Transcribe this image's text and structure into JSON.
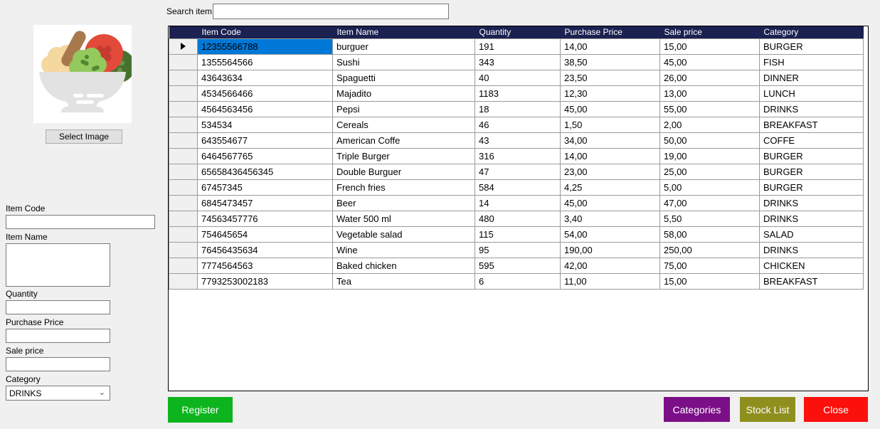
{
  "colors": {
    "header_bg": "#1b2150",
    "selection_bg": "#0078d7",
    "grid_line": "#9b9b9b",
    "register": "#0db41e",
    "categories": "#7b0f87",
    "stock_list": "#8f8f1e",
    "close": "#fb100c"
  },
  "form": {
    "select_image_label": "Select Image",
    "fields": {
      "item_code_label": "Item Code",
      "item_name_label": "Item Name",
      "quantity_label": "Quantity",
      "purchase_price_label": "Purchase Price",
      "sale_price_label": "Sale price",
      "category_label": "Category",
      "category_value": "DRINKS"
    }
  },
  "search": {
    "label": "Search item",
    "value": ""
  },
  "grid": {
    "columns": [
      "Item Code",
      "Item Name",
      "Quantity",
      "Purchase Price",
      "Sale price",
      "Category"
    ],
    "selected_row_index": 0,
    "rows": [
      [
        "12355566788",
        "burguer",
        "191",
        "14,00",
        "15,00",
        "BURGER"
      ],
      [
        "1355564566",
        "Sushi",
        "343",
        "38,50",
        "45,00",
        "FISH"
      ],
      [
        "43643634",
        "Spaguetti",
        "40",
        "23,50",
        "26,00",
        "DINNER"
      ],
      [
        "4534566466",
        "Majadito",
        "1183",
        "12,30",
        "13,00",
        "LUNCH"
      ],
      [
        "4564563456",
        "Pepsi",
        "18",
        "45,00",
        "55,00",
        "DRINKS"
      ],
      [
        "534534",
        "Cereals",
        "46",
        "1,50",
        "2,00",
        "BREAKFAST"
      ],
      [
        "643554677",
        "American Coffe",
        "43",
        "34,00",
        "50,00",
        "COFFE"
      ],
      [
        "6464567765",
        "Triple Burger",
        "316",
        "14,00",
        "19,00",
        "BURGER"
      ],
      [
        "65658436456345",
        "Double Burguer",
        "47",
        "23,00",
        "25,00",
        "BURGER"
      ],
      [
        "67457345",
        "French fries",
        "584",
        "4,25",
        "5,00",
        "BURGER"
      ],
      [
        "6845473457",
        "Beer",
        "14",
        "45,00",
        "47,00",
        "DRINKS"
      ],
      [
        "74563457776",
        "Water 500 ml",
        "480",
        "3,40",
        "5,50",
        "DRINKS"
      ],
      [
        "754645654",
        "Vegetable salad",
        "115",
        "54,00",
        "58,00",
        "SALAD"
      ],
      [
        "76456435634",
        "Wine",
        "95",
        "190,00",
        "250,00",
        "DRINKS"
      ],
      [
        "7774564563",
        "Baked chicken",
        "595",
        "42,00",
        "75,00",
        "CHICKEN"
      ],
      [
        "7793253002183",
        "Tea",
        "6",
        "11,00",
        "15,00",
        "BREAKFAST"
      ]
    ]
  },
  "buttons": {
    "register_label": "Register",
    "categories_label": "Categories",
    "stock_list_label": "Stock List",
    "close_label": "Close"
  }
}
